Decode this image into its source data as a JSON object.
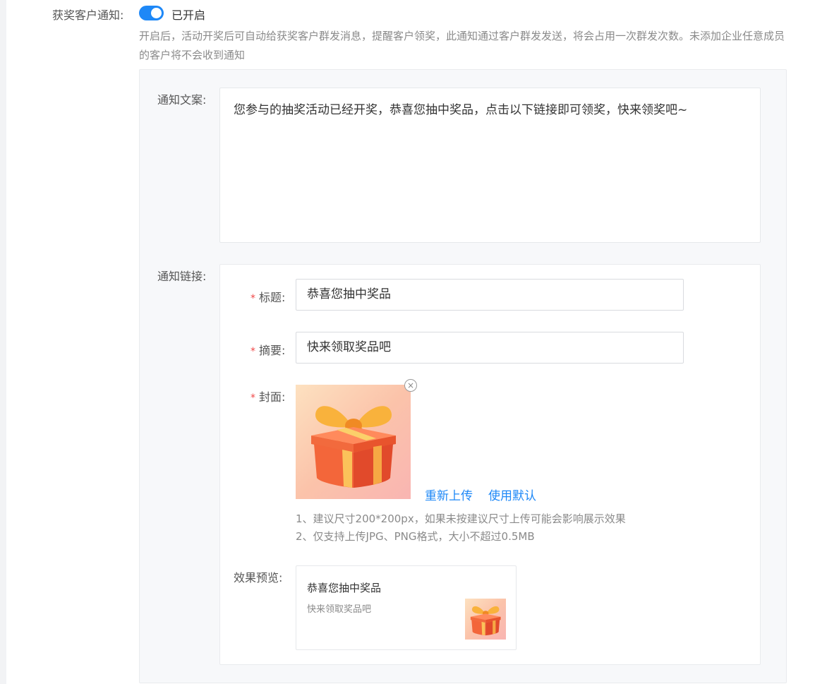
{
  "notify": {
    "label": "获奖客户通知:",
    "toggle_on": true,
    "status_text": "已开启",
    "description": "开启后，活动开奖后可自动给获奖客户群发消息，提醒客户领奖，此通知通过客户群发发送，将会占用一次群发次数。未添加企业任意成员的客户将不会收到通知"
  },
  "copy": {
    "label": "通知文案:",
    "value": "您参与的抽奖活动已经开奖，恭喜您抽中奖品，点击以下链接即可领奖，快来领奖吧~"
  },
  "link": {
    "label": "通知链接:",
    "required_mark": "*",
    "title_label": "标题:",
    "title_value": "恭喜您抽中奖品",
    "summary_label": "摘要:",
    "summary_value": "快来领取奖品吧",
    "cover_label": "封面:",
    "close_symbol": "×",
    "reupload_label": "重新上传",
    "use_default_label": "使用默认",
    "hint_1": "1、建议尺寸200*200px，如果未按建议尺寸上传可能会影响展示效果",
    "hint_2": "2、仅支持上传JPG、PNG格式，大小不超过0.5MB"
  },
  "preview": {
    "label": "效果预览:",
    "title": "恭喜您抽中奖品",
    "desc": "快来领取奖品吧"
  },
  "colors": {
    "accent": "#1e88f7",
    "required": "#f04848"
  },
  "icons": {
    "cover_image": "gift-box-image",
    "close": "close-icon"
  }
}
